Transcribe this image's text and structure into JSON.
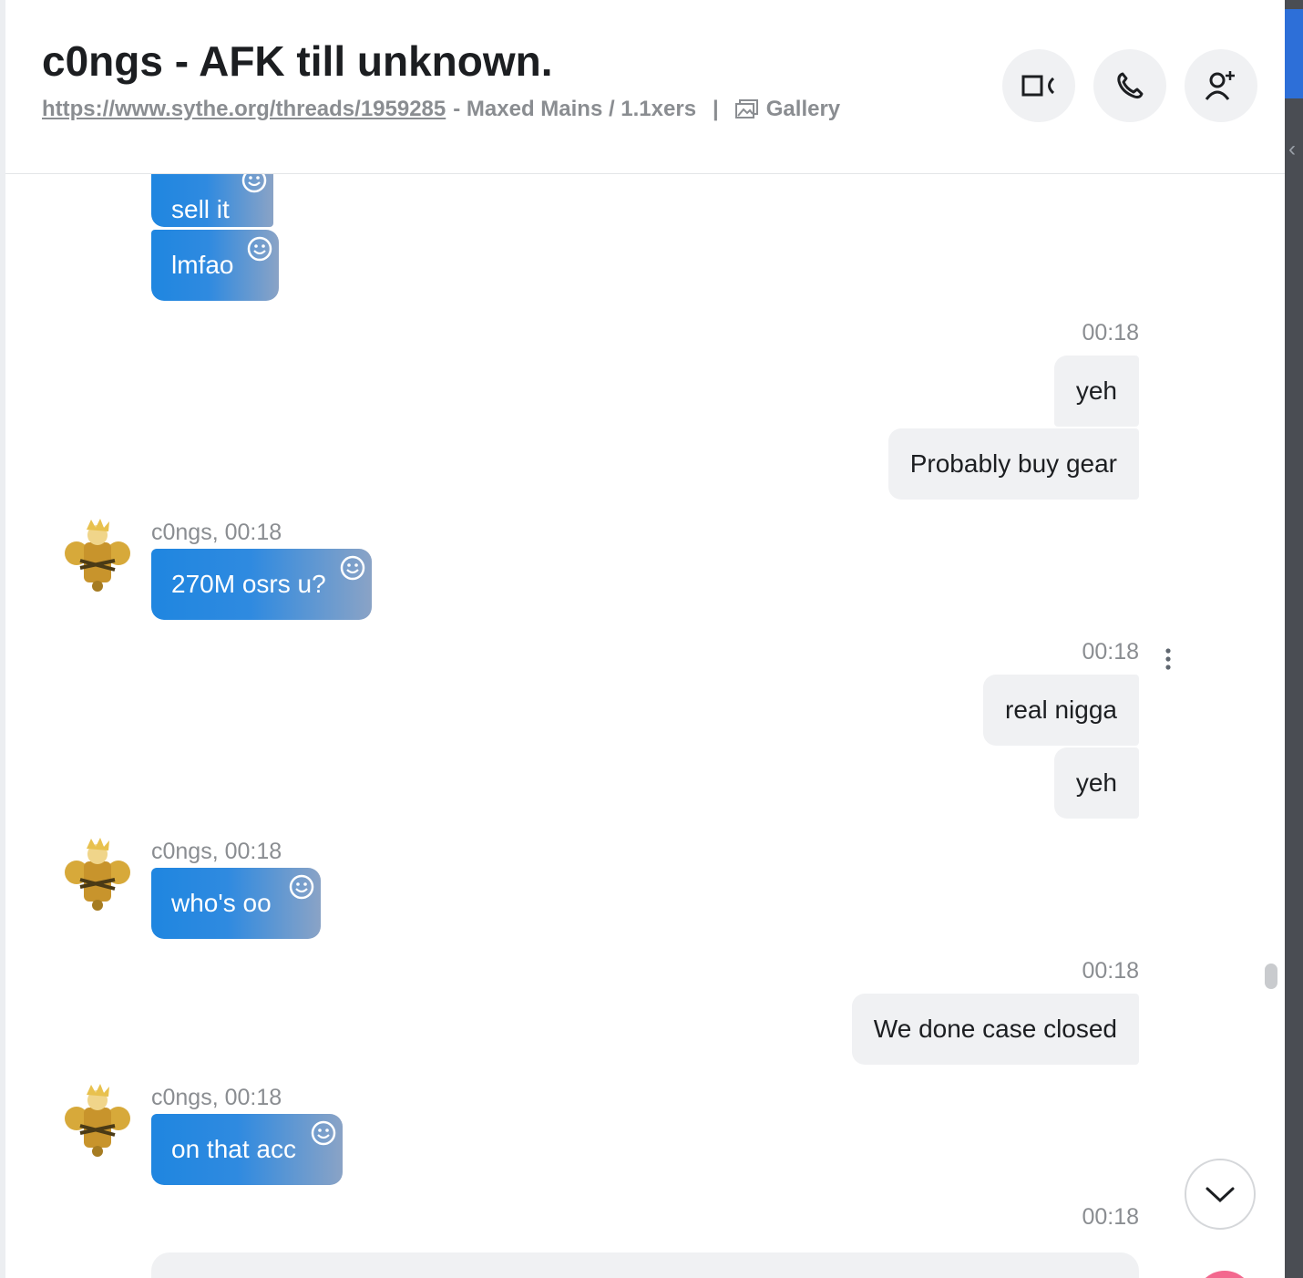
{
  "header": {
    "title": "c0ngs - AFK till unknown.",
    "link": "https://www.sythe.org/threads/1959285",
    "description": "- Maxed Mains / 1.1xers",
    "separator": "|",
    "gallery_label": "Gallery"
  },
  "header_actions": [
    {
      "icon": "video-camera-icon"
    },
    {
      "icon": "phone-icon"
    },
    {
      "icon": "add-person-icon"
    }
  ],
  "messages": {
    "in_sell_it": "sell it",
    "in_lmfao": "lmfao",
    "out_time_1": "00:18",
    "out_yeh_1": "yeh",
    "out_probably": "Probably buy gear",
    "in_meta_1": "c0ngs, 00:18",
    "in_270m": "270M osrs u?",
    "out_time_2": "00:18",
    "out_real": "real nigga",
    "out_yeh_2": "yeh",
    "in_meta_2": "c0ngs, 00:18",
    "in_whos": "who's oo",
    "out_time_3": "00:18",
    "out_done": "We done case closed",
    "in_meta_3": "c0ngs, 00:18",
    "in_acc": "on that acc",
    "out_time_4": "00:18"
  },
  "colors": {
    "incoming_bubble_start": "#1f86e0",
    "incoming_bubble_end": "#8aa3c6",
    "outgoing_bubble": "#f0f1f3",
    "send_button": "#f3688e"
  }
}
